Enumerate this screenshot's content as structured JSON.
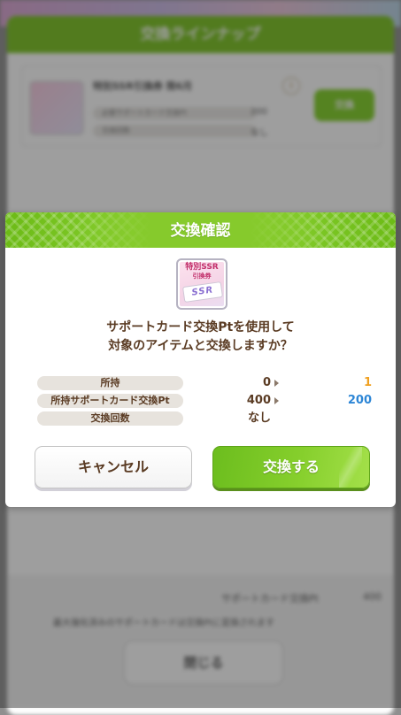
{
  "background": {
    "header_title": "交換ラインナップ",
    "item": {
      "title": "特別SSR引換券 限6月",
      "rows": [
        {
          "label": "必要サポートカード交換Pt",
          "value": "200"
        },
        {
          "label": "交換回数",
          "value": "なし"
        }
      ],
      "info_icon": "i",
      "exchange_label": "交換"
    },
    "pt_label": "サポートカード交換Pt",
    "pt_value": "400",
    "note": "最大強化済みのサポートカードは交換Ptに変換されます",
    "close_label": "閉じる"
  },
  "modal": {
    "title": "交換確認",
    "item_icon": {
      "name": "ssr-exchange-ticket-icon",
      "label_line1": "特別SSR",
      "label_line2": "引換券",
      "card_text": "SSR"
    },
    "question_line1": "サポートカード交換Ptを使用して",
    "question_line2": "対象のアイテムと交換しますか？",
    "stats": [
      {
        "label": "所持",
        "before": "0",
        "after": "1",
        "after_color": "#f0a020"
      },
      {
        "label": "所持サポートカード交換Pt",
        "before": "400",
        "after": "200",
        "after_color": "#2d86d6"
      },
      {
        "label": "交換回数",
        "before": "なし",
        "after": "",
        "after_color": "#5a3b23"
      }
    ],
    "cancel_label": "キャンセル",
    "confirm_label": "交換する"
  },
  "colors": {
    "accent_green": "#82c529",
    "text_brown": "#5a3b23"
  }
}
